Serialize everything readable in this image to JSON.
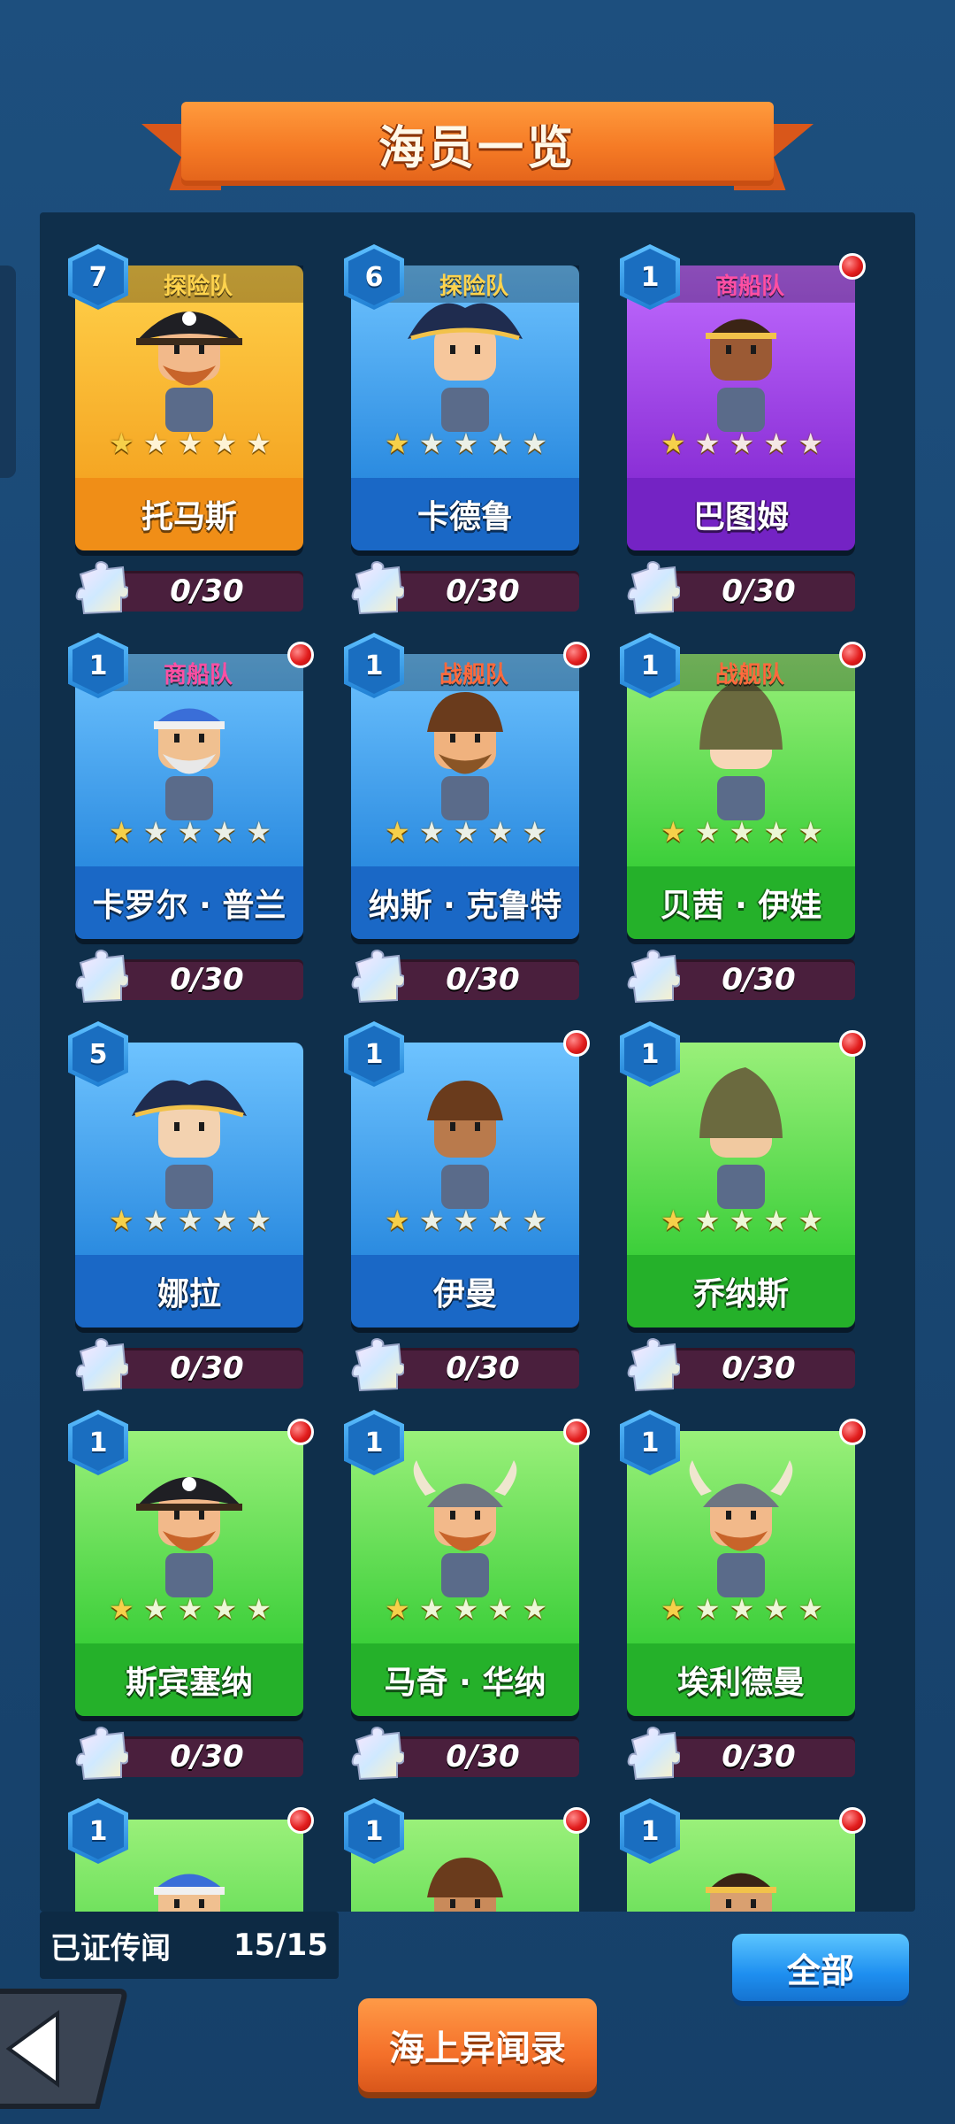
{
  "title": "海员一览",
  "cards": [
    {
      "level": "7",
      "team": "探险队",
      "team_color": "#ffd34d",
      "name": "托马斯",
      "stars": 1,
      "theme": "gold",
      "dot": false,
      "progress": "0/30",
      "hat": "pirate",
      "skin": "#f2b98a",
      "beard": "#c8642a"
    },
    {
      "level": "6",
      "team": "探险队",
      "team_color": "#ffd34d",
      "name": "卡德鲁",
      "stars": 1,
      "theme": "blue",
      "dot": false,
      "progress": "0/30",
      "hat": "tricorn",
      "skin": "#f6c79c",
      "beard": "none"
    },
    {
      "level": "1",
      "team": "商船队",
      "team_color": "#ff4fa3",
      "name": "巴图姆",
      "stars": 1,
      "theme": "purple",
      "dot": true,
      "progress": "0/30",
      "hat": "band",
      "skin": "#9b5a34",
      "beard": "none"
    },
    {
      "level": "1",
      "team": "商船队",
      "team_color": "#ff4fa3",
      "name": "卡罗尔 · 普兰",
      "stars": 1,
      "theme": "blue",
      "dot": true,
      "progress": "0/30",
      "hat": "bandana",
      "skin": "#f0c090",
      "beard": "#e8e8e8"
    },
    {
      "level": "1",
      "team": "战舰队",
      "team_color": "#ff6a3d",
      "name": "纳斯 · 克鲁特",
      "stars": 1,
      "theme": "blue",
      "dot": true,
      "progress": "0/30",
      "hat": "hair",
      "skin": "#f0b27e",
      "beard": "#8a5526"
    },
    {
      "level": "1",
      "team": "战舰队",
      "team_color": "#ff6a3d",
      "name": "贝茜 · 伊娃",
      "stars": 1,
      "theme": "green",
      "dot": true,
      "progress": "0/30",
      "hat": "hood",
      "skin": "#f7d6b8",
      "beard": "none"
    },
    {
      "level": "5",
      "team": "",
      "team_color": "#ffffff",
      "name": "娜拉",
      "stars": 1,
      "theme": "blue",
      "dot": false,
      "progress": "0/30",
      "hat": "tricorn",
      "skin": "#f3d2b0",
      "beard": "none"
    },
    {
      "level": "1",
      "team": "",
      "team_color": "#ffffff",
      "name": "伊曼",
      "stars": 1,
      "theme": "blue",
      "dot": true,
      "progress": "0/30",
      "hat": "hair",
      "skin": "#b97a4c",
      "beard": "none"
    },
    {
      "level": "1",
      "team": "",
      "team_color": "#ffffff",
      "name": "乔纳斯",
      "stars": 1,
      "theme": "green",
      "dot": true,
      "progress": "0/30",
      "hat": "hood",
      "skin": "#f1c9a0",
      "beard": "none"
    },
    {
      "level": "1",
      "team": "",
      "team_color": "#ffffff",
      "name": "斯宾塞纳",
      "stars": 1,
      "theme": "green",
      "dot": true,
      "progress": "0/30",
      "hat": "pirate",
      "skin": "#f2b98a",
      "beard": "#c8642a"
    },
    {
      "level": "1",
      "team": "",
      "team_color": "#ffffff",
      "name": "马奇 · 华纳",
      "stars": 1,
      "theme": "green",
      "dot": true,
      "progress": "0/30",
      "hat": "viking",
      "skin": "#f2b98a",
      "beard": "#c8642a"
    },
    {
      "level": "1",
      "team": "",
      "team_color": "#ffffff",
      "name": "埃利德曼",
      "stars": 1,
      "theme": "green",
      "dot": true,
      "progress": "0/30",
      "hat": "viking",
      "skin": "#f2b98a",
      "beard": "#c8642a"
    },
    {
      "level": "1",
      "team": "",
      "team_color": "#ffffff",
      "name": "",
      "stars": 0,
      "theme": "green",
      "dot": true,
      "progress": "",
      "hat": "bandana",
      "skin": "#f0c090",
      "beard": "none"
    },
    {
      "level": "1",
      "team": "",
      "team_color": "#ffffff",
      "name": "",
      "stars": 0,
      "theme": "green",
      "dot": true,
      "progress": "",
      "hat": "hair",
      "skin": "#c98a5a",
      "beard": "none"
    },
    {
      "level": "1",
      "team": "",
      "team_color": "#ffffff",
      "name": "",
      "stars": 0,
      "theme": "green",
      "dot": true,
      "progress": "",
      "hat": "band",
      "skin": "#d9a070",
      "beard": "none"
    }
  ],
  "legend": {
    "label": "已证传闻",
    "count": "15/15"
  },
  "buttons": {
    "all": "全部",
    "journal": "海上异闻录"
  },
  "icons": {
    "back": "back-arrow-icon",
    "fragment": "puzzle-piece-icon",
    "level": "hexagon-badge-icon",
    "notify": "red-dot-icon",
    "star": "star-icon"
  },
  "colors": {
    "gold": "#f5a623",
    "blue": "#1f78d1",
    "purple": "#8a2fd6",
    "green": "#33c23a"
  }
}
